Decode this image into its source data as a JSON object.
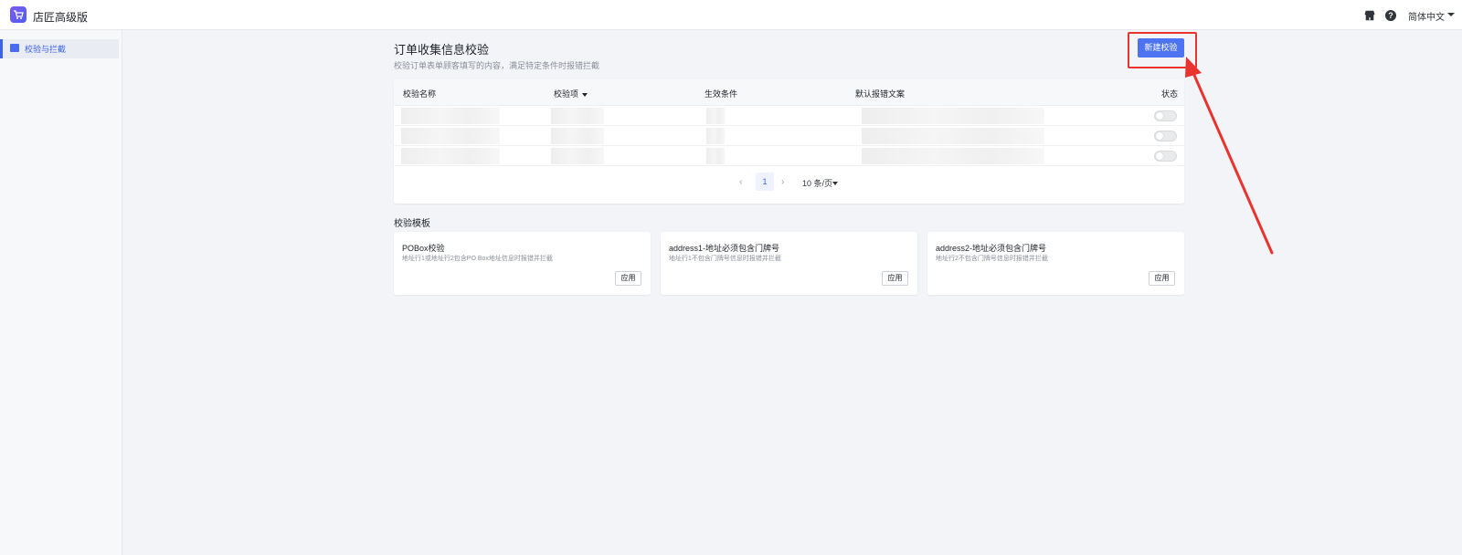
{
  "app": {
    "name": "店匠高级版"
  },
  "topbar": {
    "language": "简体中文"
  },
  "sidebar": {
    "items": [
      {
        "label": "校验与拦截",
        "active": true
      }
    ]
  },
  "page": {
    "title": "订单收集信息校验",
    "description": "校验订单表单顾客填写的内容，满足特定条件时报错拦截",
    "new_button": "新建校验"
  },
  "table": {
    "columns": [
      "校验名称",
      "校验项",
      "生效条件",
      "默认报错文案",
      "状态"
    ],
    "rows": [
      {
        "status": "off"
      },
      {
        "status": "off"
      },
      {
        "status": "off"
      }
    ],
    "pagination": {
      "current_page": "1",
      "page_size": "10 条/页"
    }
  },
  "templates": {
    "section_title": "校验模板",
    "cards": [
      {
        "title": "POBox校验",
        "description": "地址行1或地址行2包含PO Box地址信息时报错并拦截",
        "button": "应用"
      },
      {
        "title": "address1-地址必须包含门牌号",
        "description": "地址行1不包含门牌号信息时报错并拦截",
        "button": "应用"
      },
      {
        "title": "address2-地址必须包含门牌号",
        "description": "地址行2不包含门牌号信息时报错并拦截",
        "button": "应用"
      }
    ]
  },
  "colors": {
    "accent": "#4d73f0",
    "annotation": "#e8332e"
  }
}
